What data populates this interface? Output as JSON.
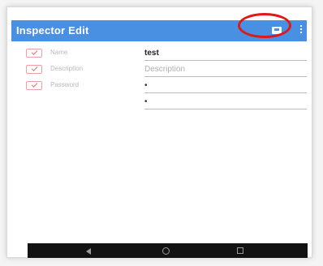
{
  "app_bar": {
    "title": "Inspector Edit",
    "save_icon": "save-icon",
    "menu_icon": "overflow-menu-icon",
    "color": "#4a90e2"
  },
  "annotation": {
    "highlight_color": "#e01818"
  },
  "form": {
    "fields": [
      {
        "label": "Name",
        "value": "test",
        "checked": true
      },
      {
        "label": "Description",
        "placeholder": "Description",
        "checked": true
      },
      {
        "label": "Password",
        "value": "•",
        "checked": true
      }
    ],
    "confirm_password": {
      "value": "•"
    }
  },
  "nav_bar": {
    "back_icon": "back-icon",
    "home_icon": "home-icon",
    "recent_icon": "recent-apps-icon"
  }
}
